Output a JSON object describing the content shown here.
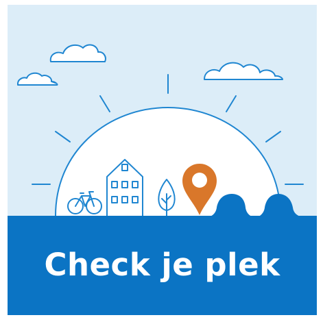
{
  "tile": {
    "title": "Check je plek"
  },
  "colors": {
    "sky": "#dcedf8",
    "line": "#1f86d1",
    "pin": "#d9772a",
    "banner": "#0b74c4",
    "text": "#ffffff"
  },
  "icons": [
    "cloud-icon",
    "sun-icon",
    "bicycle-icon",
    "house-icon",
    "tree-icon",
    "location-pin-icon",
    "water-wave-icon"
  ]
}
